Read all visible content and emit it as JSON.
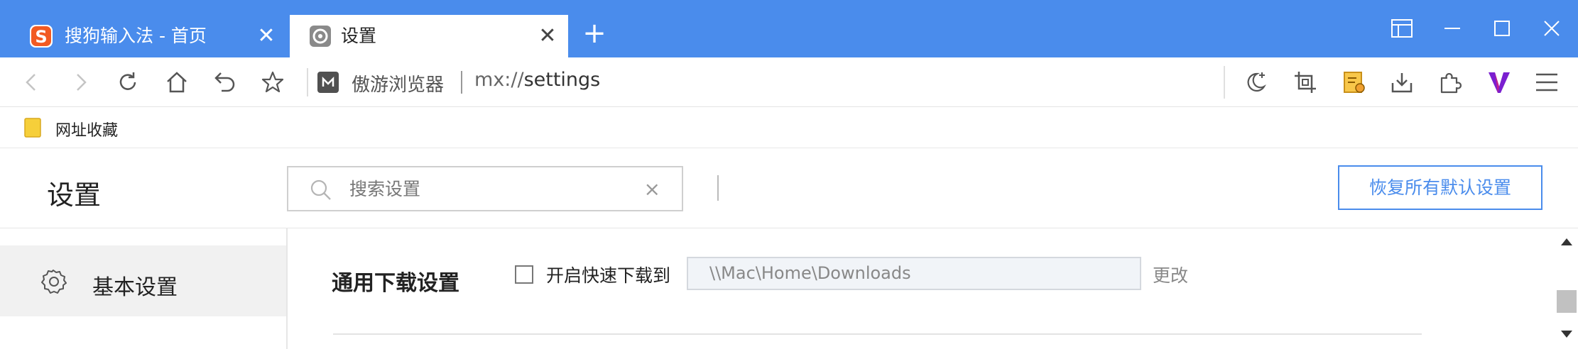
{
  "tabs": [
    {
      "title": "搜狗输入法 - 首页",
      "icon": "sogou-icon",
      "close": "✕"
    },
    {
      "title": "设置",
      "icon": "settings-tab-icon",
      "close": "✕"
    }
  ],
  "new_tab_label": "+",
  "window_controls": [
    "tile-icon",
    "minimize-icon",
    "maximize-icon",
    "close-window-icon"
  ],
  "toolbar": {
    "nav_icons": [
      "back-icon",
      "forward-icon",
      "reload-icon",
      "home-icon",
      "undo-icon",
      "star-icon"
    ],
    "site_name": "傲游浏览器",
    "url_scheme": "mx://",
    "url_path": "settings",
    "right_icons": [
      "night-mode-icon",
      "screenshot-icon",
      "notes-icon",
      "download-icon",
      "extensions-icon",
      "v-logo-icon",
      "menu-icon"
    ]
  },
  "bookmarks": {
    "folder_label": "网址收藏"
  },
  "settings": {
    "title": "设置",
    "search_placeholder": "搜索设置",
    "search_clear": "×",
    "reset_button": "恢复所有默认设置",
    "sidebar": [
      {
        "label": "基本设置",
        "icon": "gear-icon",
        "active": true
      }
    ],
    "download": {
      "section_title": "通用下载设置",
      "quick_download_label": "开启快速下载到",
      "quick_download_checked": false,
      "path": "\\\\Mac\\Home\\Downloads",
      "change_label": "更改"
    }
  },
  "colors": {
    "accent": "#4a8cec",
    "sidebar_active_bg": "#f1f1f1"
  }
}
